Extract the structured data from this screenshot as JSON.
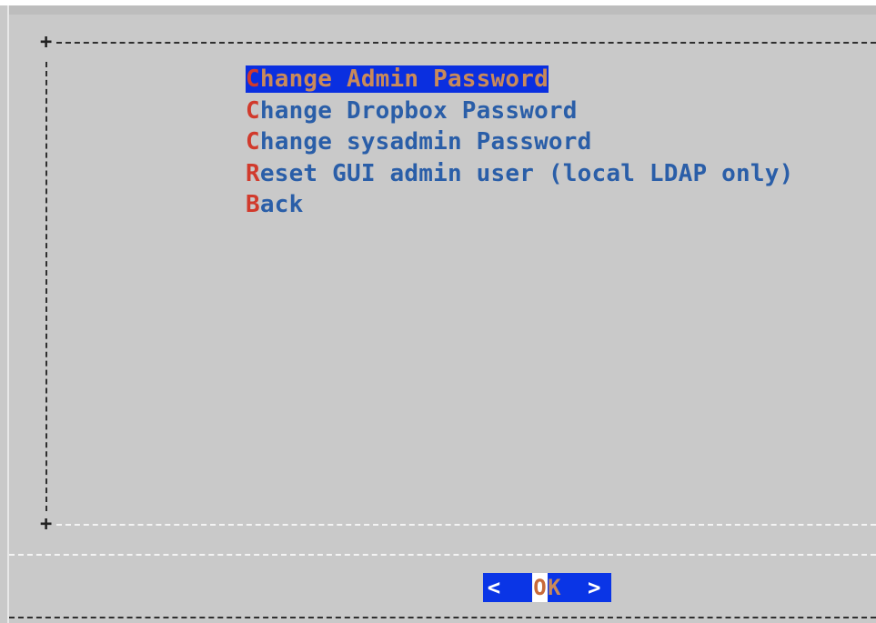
{
  "menu": {
    "items": [
      {
        "hotkey": "C",
        "rest": "hange Admin Password",
        "selected": true
      },
      {
        "hotkey": "C",
        "rest": "hange Dropbox Password",
        "selected": false
      },
      {
        "hotkey": "C",
        "rest": "hange sysadmin Password",
        "selected": false
      },
      {
        "hotkey": "R",
        "rest": "eset GUI admin user (local LDAP only)",
        "selected": false
      },
      {
        "hotkey": "B",
        "rest": "ack",
        "selected": false
      }
    ]
  },
  "buttons": {
    "ok": {
      "left": "<",
      "hotkey": "O",
      "rest": "K",
      "right": ">"
    }
  },
  "box": {
    "corner_top": "+",
    "corner_bottom": "+"
  },
  "colors": {
    "background": "#c9c9c9",
    "item_text": "#2a5ea8",
    "hotkey": "#d13a2c",
    "selection": "#0a2fe0"
  }
}
